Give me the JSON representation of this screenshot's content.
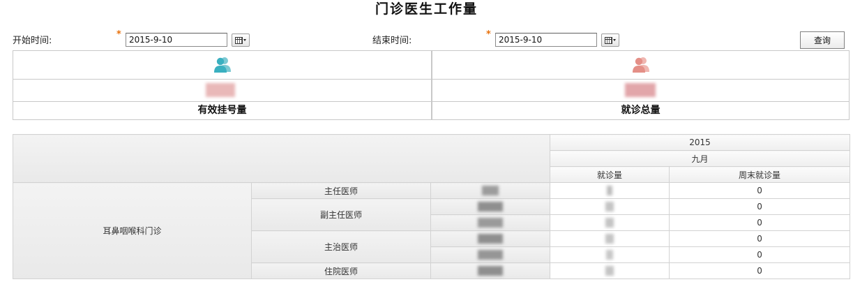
{
  "page": {
    "title": "门诊医生工作量"
  },
  "filters": {
    "start_label": "开始时间:",
    "start_value": "2015-9-10",
    "end_label": "结束时间:",
    "end_value": "2015-9-10",
    "required_mark": "*",
    "query_label": "查询"
  },
  "summary": {
    "registrations_label": "有效挂号量",
    "visits_label": "就诊总量"
  },
  "report": {
    "year": "2015",
    "month": "九月",
    "col_visits": "就诊量",
    "col_weekend_visits": "周末就诊量",
    "department": "耳鼻咽喉科门诊",
    "rows": [
      {
        "title": "主任医师",
        "weekend": "0"
      },
      {
        "title": "副主任医师",
        "weekend": "0"
      },
      {
        "title": "",
        "weekend": "0"
      },
      {
        "title": "主治医师",
        "weekend": "0"
      },
      {
        "title": "",
        "weekend": "0"
      },
      {
        "title": "住院医师",
        "weekend": "0"
      }
    ]
  },
  "colors": {
    "required": "#e8700a",
    "icon_registrations": "#3ab0c0",
    "icon_visits": "#e48f87"
  }
}
